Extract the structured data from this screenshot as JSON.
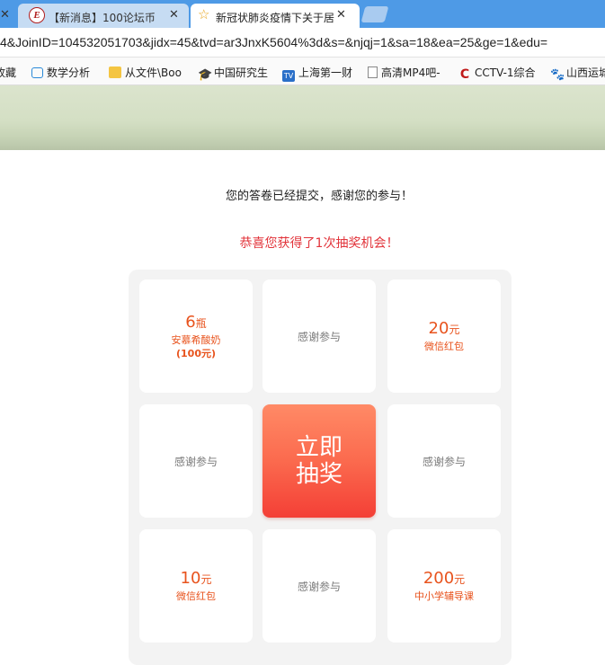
{
  "browser": {
    "tabs": [
      {
        "close": "✕"
      },
      {
        "icon_letter": "E",
        "title": "【新消息】100论坛币",
        "close": "✕"
      },
      {
        "icon": "☆",
        "title": "新冠状肺炎疫情下关于居",
        "close": "✕"
      }
    ],
    "url": "4&JoinID=104532051703&jidx=45&tvd=ar3JnxK5604%3d&s=&njqj=1&sa=18&ea=25&ge=1&edu=",
    "bookmarks": [
      {
        "icon": "",
        "label": "收藏"
      },
      {
        "icon": "",
        "label": "数学分析"
      },
      {
        "icon": "",
        "label": "从文件\\Boo"
      },
      {
        "icon": "🎓",
        "label": "中国研究生"
      },
      {
        "icon": "TV",
        "label": "上海第一财"
      },
      {
        "icon": "",
        "label": "高清MP4吧-"
      },
      {
        "icon": "C",
        "label": "CCTV-1综合"
      },
      {
        "icon": "🐾",
        "label": "山西运城"
      }
    ]
  },
  "page": {
    "submitted_message": "您的答卷已经提交，感谢您的参与！",
    "congrats_message": "恭喜您获得了1次抽奖机会！",
    "draw_button": {
      "line1": "立即",
      "line2": "抽奖"
    },
    "prizes": {
      "p0": {
        "amount": "6",
        "unit": "瓶",
        "desc": "安慕希酸奶",
        "note": "(100元)"
      },
      "p1": {
        "text": "感谢参与"
      },
      "p2": {
        "amount": "20",
        "unit": "元",
        "desc": "微信红包"
      },
      "p3": {
        "text": "感谢参与"
      },
      "p5": {
        "text": "感谢参与"
      },
      "p6": {
        "amount": "10",
        "unit": "元",
        "desc": "微信红包"
      },
      "p7": {
        "text": "感谢参与"
      },
      "p8": {
        "amount": "200",
        "unit": "元",
        "desc": "中小学辅导课"
      }
    }
  },
  "colors": {
    "accent_red": "#e2343b",
    "prize_orange": "#e8531d",
    "tabstrip_blue": "#4e9ae6"
  }
}
